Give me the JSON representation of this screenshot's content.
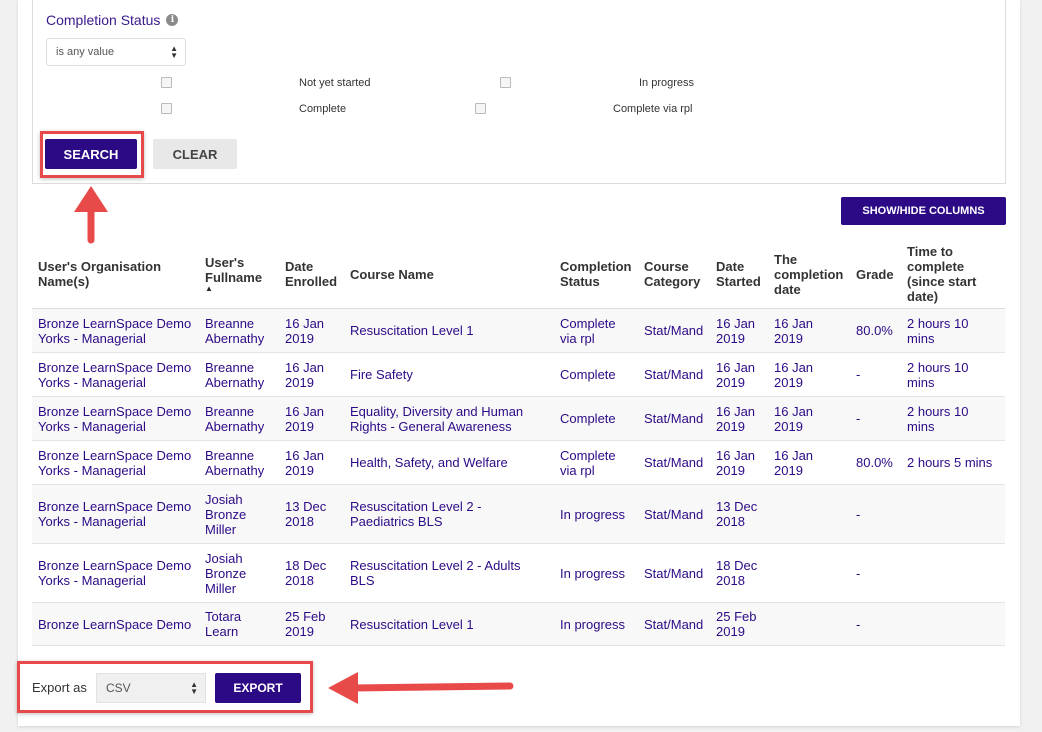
{
  "filter": {
    "label": "Completion Status",
    "info_icon": "info-icon",
    "operator_select": "is any value",
    "options": [
      {
        "label": "Not yet started"
      },
      {
        "label": "In progress"
      },
      {
        "label": "Complete"
      },
      {
        "label": "Complete via rpl"
      }
    ],
    "search_label": "SEARCH",
    "clear_label": "CLEAR"
  },
  "toolbar": {
    "show_hide_label": "SHOW/HIDE COLUMNS"
  },
  "table": {
    "columns": [
      "User's Organisation Name(s)",
      "User's Fullname",
      "Date Enrolled",
      "Course Name",
      "Completion Status",
      "Course Category",
      "Date Started",
      "The completion date",
      "Grade",
      "Time to complete (since start date)"
    ],
    "rows": [
      [
        "Bronze LearnSpace Demo Yorks - Managerial",
        "Breanne Abernathy",
        "16 Jan 2019",
        "Resuscitation Level 1",
        "Complete via rpl",
        "Stat/Mand",
        "16 Jan 2019",
        "16 Jan 2019",
        "80.0%",
        "2 hours 10 mins"
      ],
      [
        "Bronze LearnSpace Demo Yorks - Managerial",
        "Breanne Abernathy",
        "16 Jan 2019",
        "Fire Safety",
        "Complete",
        "Stat/Mand",
        "16 Jan 2019",
        "16 Jan 2019",
        "-",
        "2 hours 10 mins"
      ],
      [
        "Bronze LearnSpace Demo Yorks - Managerial",
        "Breanne Abernathy",
        "16 Jan 2019",
        "Equality, Diversity and Human Rights - General Awareness",
        "Complete",
        "Stat/Mand",
        "16 Jan 2019",
        "16 Jan 2019",
        "-",
        "2 hours 10 mins"
      ],
      [
        "Bronze LearnSpace Demo Yorks - Managerial",
        "Breanne Abernathy",
        "16 Jan 2019",
        "Health, Safety, and Welfare",
        "Complete via rpl",
        "Stat/Mand",
        "16 Jan 2019",
        "16 Jan 2019",
        "80.0%",
        "2 hours 5 mins"
      ],
      [
        "Bronze LearnSpace Demo Yorks - Managerial",
        "Josiah Bronze Miller",
        "13 Dec 2018",
        "Resuscitation Level 2 - Paediatrics BLS",
        "In progress",
        "Stat/Mand",
        "13 Dec 2018",
        "",
        "-",
        ""
      ],
      [
        "Bronze LearnSpace Demo Yorks - Managerial",
        "Josiah Bronze Miller",
        "18 Dec 2018",
        "Resuscitation Level 2 - Adults BLS",
        "In progress",
        "Stat/Mand",
        "18 Dec 2018",
        "",
        "-",
        ""
      ],
      [
        "Bronze LearnSpace Demo",
        "Totara Learn",
        "25 Feb 2019",
        "Resuscitation Level 1",
        "In progress",
        "Stat/Mand",
        "25 Feb 2019",
        "",
        "-",
        ""
      ]
    ]
  },
  "export": {
    "label": "Export as",
    "format": "CSV",
    "button_label": "EXPORT"
  },
  "colors": {
    "accent": "#2c0a86",
    "highlight": "#e84a4a"
  }
}
